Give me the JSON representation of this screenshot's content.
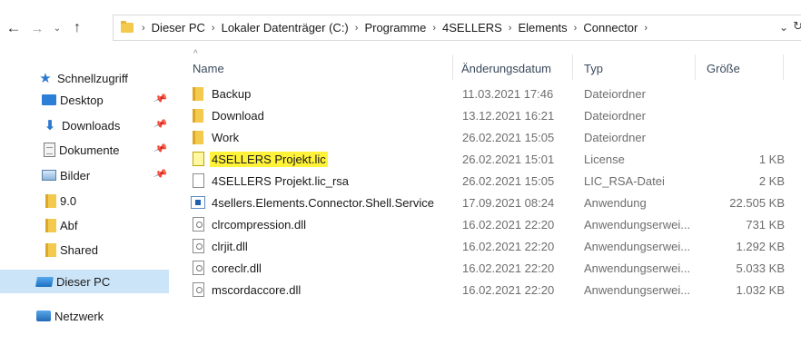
{
  "nav": {
    "back": "←",
    "forward": "→",
    "recent": "⌄",
    "up": "↑"
  },
  "breadcrumb": {
    "items": [
      "Dieser PC",
      "Lokaler Datenträger (C:)",
      "Programme",
      "4SELLERS",
      "Elements",
      "Connector"
    ],
    "separator": "›",
    "dropdown": "⌄",
    "refresh": "↻"
  },
  "sidebar": {
    "items": [
      {
        "label": "Schnellzugriff",
        "icon": "star-icon"
      },
      {
        "label": "Desktop",
        "icon": "desktop-icon",
        "pinned": true
      },
      {
        "label": "Downloads",
        "icon": "download-icon",
        "pinned": true
      },
      {
        "label": "Dokumente",
        "icon": "documents-icon",
        "pinned": true
      },
      {
        "label": "Bilder",
        "icon": "pictures-icon",
        "pinned": true
      },
      {
        "label": "9.0",
        "icon": "folder-icon"
      },
      {
        "label": "Abf",
        "icon": "folder-icon"
      },
      {
        "label": "Shared",
        "icon": "folder-icon"
      },
      {
        "label": "Dieser PC",
        "icon": "pc-icon",
        "selected": true
      },
      {
        "label": "Netzwerk",
        "icon": "network-icon"
      }
    ],
    "pin_glyph": "📌"
  },
  "columns": {
    "name": "Name",
    "date": "Änderungsdatum",
    "type": "Typ",
    "size": "Größe",
    "sort_indicator": "^"
  },
  "files": [
    {
      "name": "Backup",
      "date": "11.03.2021 17:46",
      "type": "Dateiordner",
      "size": "",
      "icon": "folder-icon"
    },
    {
      "name": "Download",
      "date": "13.12.2021 16:21",
      "type": "Dateiordner",
      "size": "",
      "icon": "folder-icon"
    },
    {
      "name": "Work",
      "date": "26.02.2021 15:05",
      "type": "Dateiordner",
      "size": "",
      "icon": "folder-icon"
    },
    {
      "name": "4SELLERS Projekt.lic",
      "date": "26.02.2021 15:01",
      "type": "License",
      "size": "1 KB",
      "icon": "license-file-icon",
      "highlight": true
    },
    {
      "name": "4SELLERS Projekt.lic_rsa",
      "date": "26.02.2021 15:05",
      "type": "LIC_RSA-Datei",
      "size": "2 KB",
      "icon": "file-icon"
    },
    {
      "name": "4sellers.Elements.Connector.Shell.Service",
      "date": "17.09.2021 08:24",
      "type": "Anwendung",
      "size": "22.505 KB",
      "icon": "application-icon"
    },
    {
      "name": "clrcompression.dll",
      "date": "16.02.2021 22:20",
      "type": "Anwendungserwei...",
      "size": "731 KB",
      "icon": "dll-file-icon"
    },
    {
      "name": "clrjit.dll",
      "date": "16.02.2021 22:20",
      "type": "Anwendungserwei...",
      "size": "1.292 KB",
      "icon": "dll-file-icon"
    },
    {
      "name": "coreclr.dll",
      "date": "16.02.2021 22:20",
      "type": "Anwendungserwei...",
      "size": "5.033 KB",
      "icon": "dll-file-icon"
    },
    {
      "name": "mscordaccore.dll",
      "date": "16.02.2021 22:20",
      "type": "Anwendungserwei...",
      "size": "1.032 KB",
      "icon": "dll-file-icon"
    }
  ],
  "colors": {
    "selection": "#cce4f7",
    "highlight": "#fff23a",
    "folder": "#f3c94e",
    "accent": "#2b78d0"
  }
}
